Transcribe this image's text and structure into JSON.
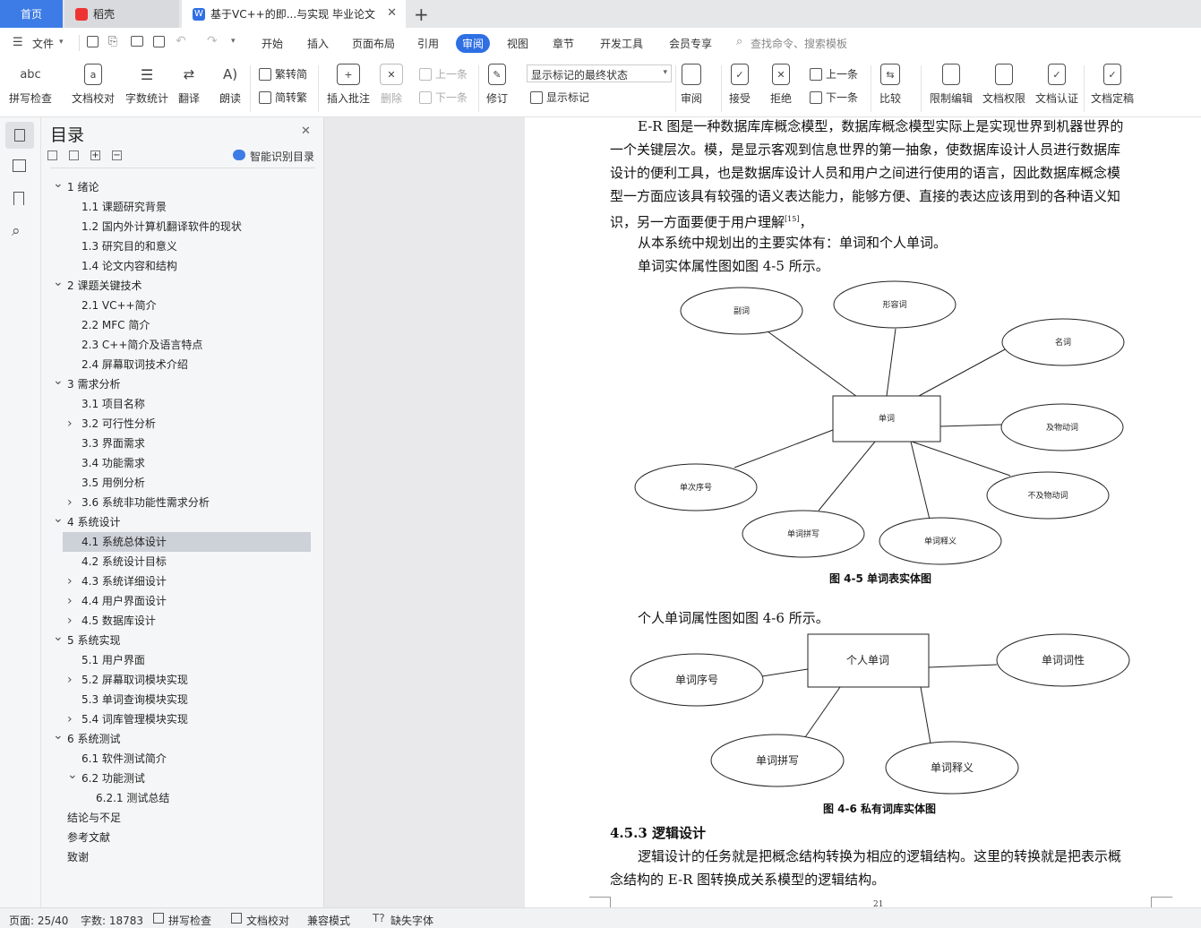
{
  "tabs": {
    "home": "首页",
    "daoke": "稻壳",
    "doc": "基于VC++的即...与实现 毕业论文"
  },
  "menu": {
    "file": "文件",
    "items": [
      "开始",
      "插入",
      "页面布局",
      "引用",
      "审阅",
      "视图",
      "章节",
      "开发工具",
      "会员专享"
    ],
    "search": "查找命令、搜索模板"
  },
  "ribbon": {
    "spell": "拼写检查",
    "proof": "文档校对",
    "count": "字数统计",
    "translate": "翻译",
    "read": "朗读",
    "t2s": "繁转简",
    "s2t": "简转繁",
    "comment": "插入批注",
    "delete": "删除",
    "prev": "上一条",
    "next": "下一条",
    "revise": "修订",
    "status_select": "显示标记的最终状态",
    "show_marks": "显示标记",
    "review": "审阅",
    "accept": "接受",
    "reject": "拒绝",
    "prev2": "上一条",
    "next2": "下一条",
    "compare": "比较",
    "restrict": "限制编辑",
    "perm": "文档权限",
    "auth": "文档认证",
    "lock": "文档定稿"
  },
  "nav": {
    "title": "目录",
    "smart": "智能识别目录",
    "items": [
      {
        "t": "1  绪论",
        "l": 0,
        "c": "v"
      },
      {
        "t": "1.1  课题研究背景",
        "l": 1,
        "c": ""
      },
      {
        "t": "1.2  国内外计算机翻译软件的现状",
        "l": 1,
        "c": ""
      },
      {
        "t": "1.3  研究目的和意义",
        "l": 1,
        "c": ""
      },
      {
        "t": "1.4  论文内容和结构",
        "l": 1,
        "c": ""
      },
      {
        "t": "2  课题关键技术",
        "l": 0,
        "c": "v"
      },
      {
        "t": "2.1  VC++简介",
        "l": 1,
        "c": ""
      },
      {
        "t": "2.2  MFC 简介",
        "l": 1,
        "c": ""
      },
      {
        "t": "2.3  C++简介及语言特点",
        "l": 1,
        "c": ""
      },
      {
        "t": "2.4  屏幕取词技术介绍",
        "l": 1,
        "c": ""
      },
      {
        "t": "3  需求分析",
        "l": 0,
        "c": "v"
      },
      {
        "t": "3.1  项目名称",
        "l": 1,
        "c": ""
      },
      {
        "t": "3.2  可行性分析",
        "l": 1,
        "c": ">"
      },
      {
        "t": "3.3  界面需求",
        "l": 1,
        "c": ""
      },
      {
        "t": "3.4  功能需求",
        "l": 1,
        "c": ""
      },
      {
        "t": "3.5  用例分析",
        "l": 1,
        "c": ""
      },
      {
        "t": "3.6  系统非功能性需求分析",
        "l": 1,
        "c": ">"
      },
      {
        "t": "4  系统设计",
        "l": 0,
        "c": "v"
      },
      {
        "t": "4.1  系统总体设计",
        "l": 1,
        "c": "",
        "sel": true
      },
      {
        "t": "4.2  系统设计目标",
        "l": 1,
        "c": ""
      },
      {
        "t": "4.3  系统详细设计",
        "l": 1,
        "c": ">"
      },
      {
        "t": "4.4  用户界面设计",
        "l": 1,
        "c": ">"
      },
      {
        "t": "4.5  数据库设计",
        "l": 1,
        "c": ">"
      },
      {
        "t": "5  系统实现",
        "l": 0,
        "c": "v"
      },
      {
        "t": "5.1  用户界面",
        "l": 1,
        "c": ""
      },
      {
        "t": "5.2  屏幕取词模块实现",
        "l": 1,
        "c": ">"
      },
      {
        "t": "5.3  单词查询模块实现",
        "l": 1,
        "c": ""
      },
      {
        "t": "5.4  词库管理模块实现",
        "l": 1,
        "c": ">"
      },
      {
        "t": "6  系统测试",
        "l": 0,
        "c": "v"
      },
      {
        "t": "6.1  软件测试简介",
        "l": 1,
        "c": ""
      },
      {
        "t": "6.2  功能测试",
        "l": 1,
        "c": "v"
      },
      {
        "t": "6.2.1  测试总结",
        "l": 2,
        "c": ""
      },
      {
        "t": "结论与不足",
        "l": -1,
        "c": ""
      },
      {
        "t": "参考文献",
        "l": -1,
        "c": ""
      },
      {
        "t": "致谢",
        "l": -1,
        "c": ""
      }
    ]
  },
  "doc": {
    "p1": [
      "E-R 图是一种数据库库概念模型，数据库概念模型实际上是实现世界到机器世界的",
      "一个关键层次。模，是显示客观到信息世界的第一抽象，使数据库设计人员进行数据库",
      "设计的便利工具，也是数据库设计人员和用户之间进行使用的语言，因此数据库概念模",
      "型一方面应该具有较强的语义表达能力，能够方便、直接的表达应该用到的各种语义知"
    ],
    "p1_last": "识，另一方面要便于用户理解",
    "cite": "[15]",
    "p1_end": "，",
    "p2": "从本系统中规划出的主要实体有：单词和个人单词。",
    "p3": "单词实体属性图如图 4-5 所示。",
    "fig1": {
      "center": "单词",
      "attrs": [
        "副词",
        "形容词",
        "名词",
        "及物动词",
        "不及物动词",
        "单词释义",
        "单词拼写",
        "单次序号"
      ],
      "caption": "图 4-5 单词表实体图"
    },
    "p4": "个人单词属性图如图 4-6 所示。",
    "fig2": {
      "center": "个人单词",
      "attrs": [
        "单词序号",
        "单词词性",
        "单词拼写",
        "单词释义"
      ],
      "caption": "图 4-6 私有词库实体图"
    },
    "h453": "4.5.3   逻辑设计",
    "p5": [
      "逻辑设计的任务就是把概念结构转换为相应的逻辑结构。这里的转换就是把表示概",
      "念结构的 E-R 图转换成关系模型的逻辑结构。"
    ],
    "pageno": "21"
  },
  "status": {
    "page": "页面: 25/40",
    "words": "字数: 18783",
    "spell": "拼写检查",
    "proof": "文档校对",
    "compat": "兼容模式",
    "font": "缺失字体"
  }
}
